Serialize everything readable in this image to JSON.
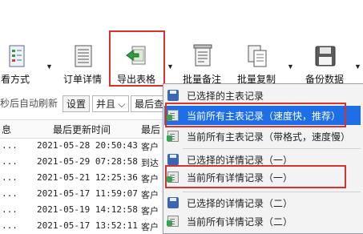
{
  "toolbar": {
    "buttons": [
      {
        "label": "查看方式",
        "icon": "view-mode-icon"
      },
      {
        "label": "订单详情",
        "icon": "order-detail-icon"
      },
      {
        "label": "导出表格",
        "icon": "export-table-icon"
      },
      {
        "label": "批量备注",
        "icon": "batch-note-icon"
      },
      {
        "label": "批量复制",
        "icon": "batch-copy-icon"
      },
      {
        "label": "备份数据",
        "icon": "backup-data-icon"
      }
    ],
    "view_mode_label_visible": "看方式"
  },
  "row2": {
    "auto_refresh": "秒后自动刷新",
    "settings_button": "设置",
    "select_value": "并且",
    "field_label": "最后查"
  },
  "table": {
    "headers": [
      "息",
      "最后更新时间",
      "最后"
    ],
    "rows": [
      {
        "c1": "...",
        "time": "2021-05-28 20:50:43",
        "c3": "客户"
      },
      {
        "c1": "...",
        "time": "2021-05-29 07:28:58",
        "c3": "到达"
      },
      {
        "c1": "...",
        "time": "2021-05-21 12:25:36",
        "c3": "客户"
      },
      {
        "c1": "...",
        "time": "2021-05-17 11:59:07",
        "c3": "客户"
      },
      {
        "c1": "...",
        "time": "2021-05-19 14:12:58",
        "c3": "客户"
      },
      {
        "c1": "...",
        "time": "2021-05-17 13:52:11",
        "c3": "客户"
      }
    ]
  },
  "menu": {
    "items": [
      {
        "label": "已选择的主表记录",
        "icon": "save-disk-icon"
      },
      {
        "label": "当前所有主表记录（速度快，推荐）",
        "icon": "excel-sheet-icon",
        "selected": true
      },
      {
        "label": "当前所有主表记录（带格式，速度慢）",
        "icon": "excel-sheet-icon"
      },
      {
        "label": "已选择的详情记录（一）",
        "icon": "save-disk-icon"
      },
      {
        "label": "当前所有详情记录（一）",
        "icon": "excel-sheet-icon"
      },
      {
        "label": "已选择的详情记录（二）",
        "icon": "save-disk-icon"
      },
      {
        "label": "当前所有详情记录（二）",
        "icon": "excel-sheet-icon"
      }
    ]
  },
  "colors": {
    "highlight": "#d9322e",
    "selection": "#1e6ee8"
  }
}
